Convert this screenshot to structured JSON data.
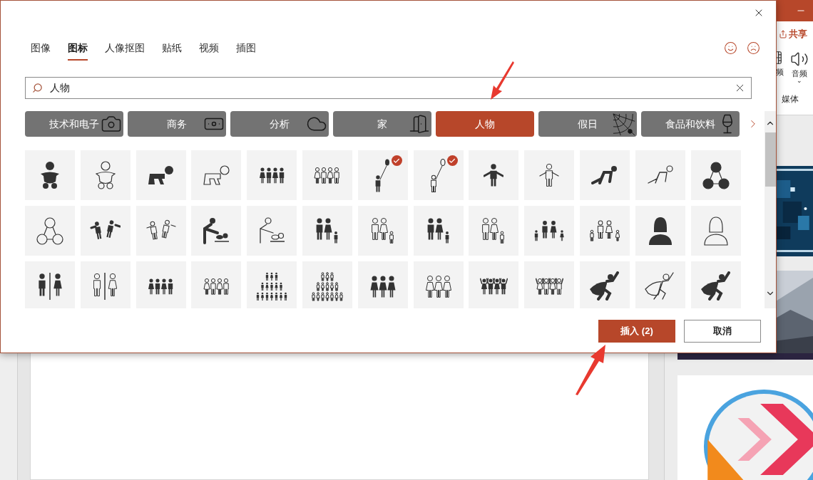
{
  "app": {
    "share_button": "共享",
    "ribbon": {
      "video_label": "频",
      "audio_label": "音频",
      "audio_caret": "⌄",
      "group_label": "媒体"
    }
  },
  "dialog": {
    "tabs": [
      {
        "label": "图像",
        "selected": false
      },
      {
        "label": "图标",
        "selected": true
      },
      {
        "label": "人像抠图",
        "selected": false
      },
      {
        "label": "贴纸",
        "selected": false
      },
      {
        "label": "视频",
        "selected": false
      },
      {
        "label": "插图",
        "selected": false
      }
    ],
    "search": {
      "value": "人物"
    },
    "categories": [
      {
        "label": "技术和电子",
        "kind": "camera",
        "selected": false
      },
      {
        "label": "商务",
        "kind": "money",
        "selected": false
      },
      {
        "label": "分析",
        "kind": "cloud",
        "selected": false
      },
      {
        "label": "家",
        "kind": "door",
        "selected": false
      },
      {
        "label": "人物",
        "kind": "none",
        "selected": true
      },
      {
        "label": "假日",
        "kind": "web",
        "selected": false
      },
      {
        "label": "食品和饮料",
        "kind": "wine",
        "selected": false
      }
    ],
    "icons": [
      {
        "kind": "baby",
        "selected": false
      },
      {
        "kind": "baby",
        "selected": false
      },
      {
        "kind": "crawl",
        "selected": false
      },
      {
        "kind": "crawl",
        "selected": false
      },
      {
        "kind": "group",
        "selected": false
      },
      {
        "kind": "group",
        "selected": false
      },
      {
        "kind": "balloon",
        "selected": true
      },
      {
        "kind": "balloon",
        "selected": true
      },
      {
        "kind": "shrug",
        "selected": false
      },
      {
        "kind": "shrug",
        "selected": false
      },
      {
        "kind": "sprint",
        "selected": false
      },
      {
        "kind": "sprint",
        "selected": false
      },
      {
        "kind": "network",
        "selected": false
      },
      {
        "kind": "network",
        "selected": false
      },
      {
        "kind": "dance",
        "selected": false
      },
      {
        "kind": "dance",
        "selected": false
      },
      {
        "kind": "changing",
        "selected": false
      },
      {
        "kind": "changing",
        "selected": false
      },
      {
        "kind": "family",
        "selected": false
      },
      {
        "kind": "family",
        "selected": false
      },
      {
        "kind": "family",
        "selected": false
      },
      {
        "kind": "family",
        "selected": false
      },
      {
        "kind": "familyfour",
        "selected": false
      },
      {
        "kind": "familyfour",
        "selected": false
      },
      {
        "kind": "woman",
        "selected": false
      },
      {
        "kind": "woman",
        "selected": false
      },
      {
        "kind": "restroom",
        "selected": false
      },
      {
        "kind": "restroom",
        "selected": false
      },
      {
        "kind": "group",
        "selected": false
      },
      {
        "kind": "group",
        "selected": false
      },
      {
        "kind": "pyramid",
        "selected": false
      },
      {
        "kind": "pyramid",
        "selected": false
      },
      {
        "kind": "trio",
        "selected": false
      },
      {
        "kind": "trio",
        "selected": false
      },
      {
        "kind": "cheer",
        "selected": false
      },
      {
        "kind": "cheer",
        "selected": false
      },
      {
        "kind": "hero",
        "selected": false
      },
      {
        "kind": "hero",
        "selected": false
      },
      {
        "kind": "hero",
        "selected": false
      }
    ],
    "buttons": {
      "insert": "插入 (2)",
      "cancel": "取消"
    }
  }
}
